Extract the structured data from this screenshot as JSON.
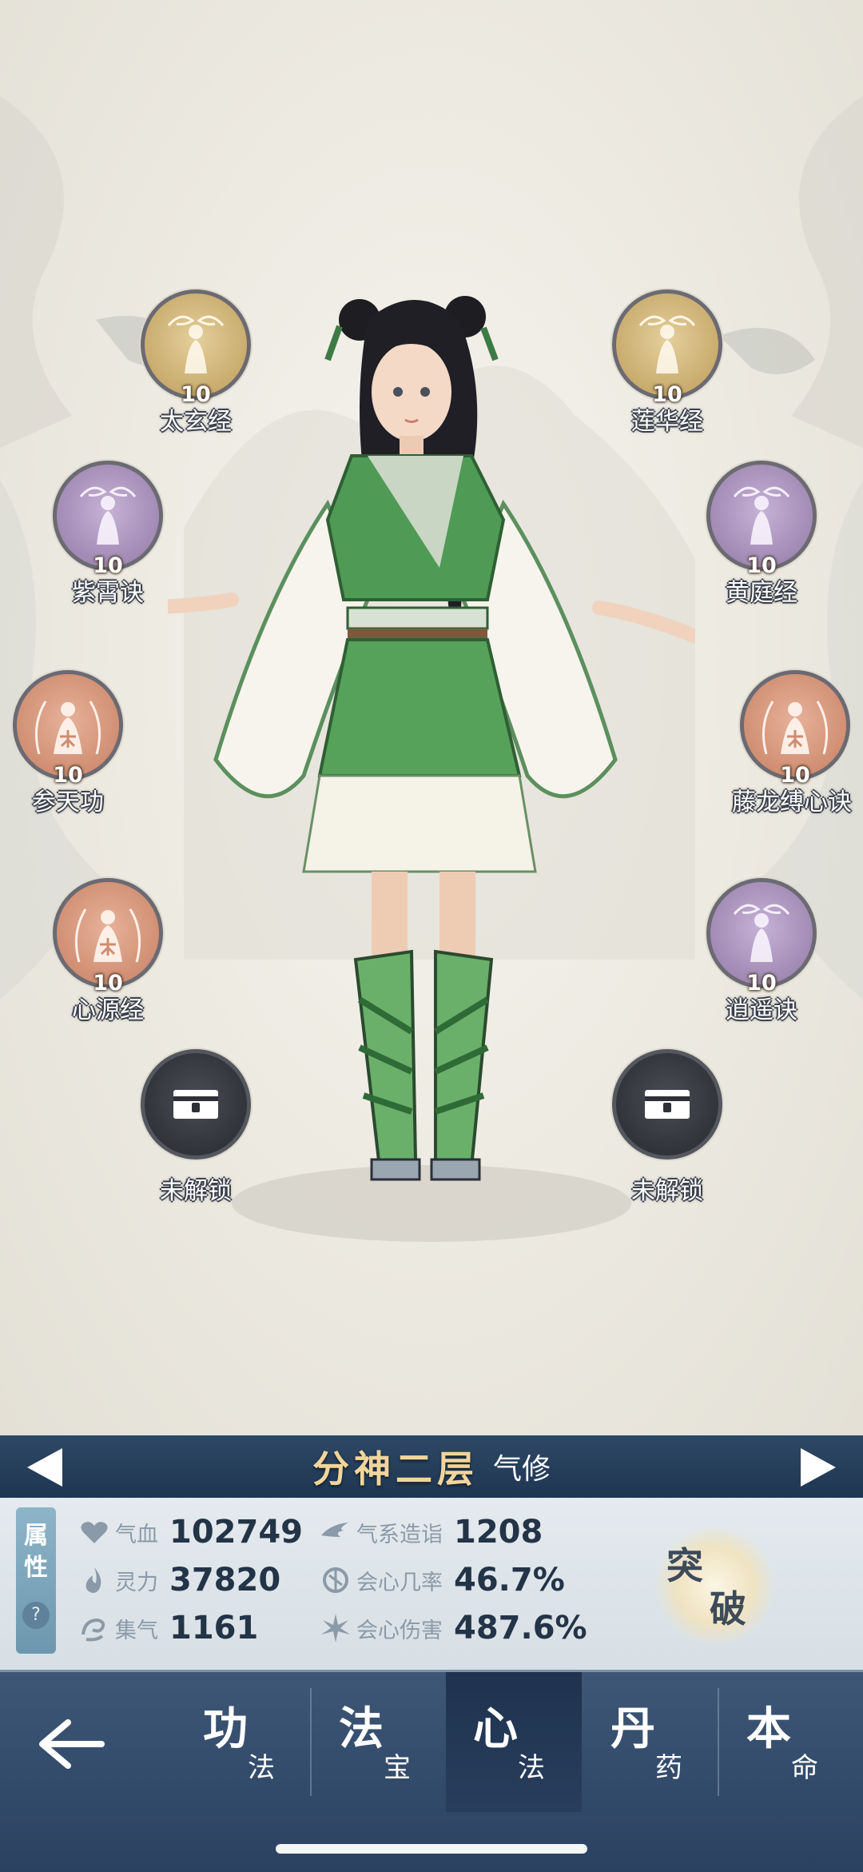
{
  "skills": [
    {
      "name": "太玄经",
      "level": "10",
      "color": "gold",
      "icon": "immortal-figure-icon"
    },
    {
      "name": "莲华经",
      "level": "10",
      "color": "gold",
      "icon": "immortal-figure-icon"
    },
    {
      "name": "紫霄诀",
      "level": "10",
      "color": "purple",
      "icon": "immortal-figure-icon"
    },
    {
      "name": "黄庭经",
      "level": "10",
      "color": "purple",
      "icon": "immortal-figure-icon"
    },
    {
      "name": "参天功",
      "level": "10",
      "color": "orange",
      "icon": "immortal-figure-icon"
    },
    {
      "name": "藤龙缚心诀",
      "level": "10",
      "color": "orange",
      "icon": "immortal-figure-icon"
    },
    {
      "name": "心源经",
      "level": "10",
      "color": "orange",
      "icon": "immortal-figure-icon"
    },
    {
      "name": "逍遥诀",
      "level": "10",
      "color": "purple",
      "icon": "immortal-figure-icon"
    }
  ],
  "locked_slots": [
    {
      "label": "未解锁",
      "icon": "lock-chest-icon"
    },
    {
      "label": "未解锁",
      "icon": "lock-chest-icon"
    }
  ],
  "realm": {
    "name": "分神二层",
    "type": "气修"
  },
  "attributes": {
    "tab_label_1": "属",
    "tab_label_2": "性",
    "help": "?",
    "stats": [
      {
        "label": "气血",
        "value": "102749",
        "icon": "heart-icon"
      },
      {
        "label": "灵力",
        "value": "37820",
        "icon": "flame-icon"
      },
      {
        "label": "集气",
        "value": "1161",
        "icon": "swirl-icon"
      },
      {
        "label": "气系造诣",
        "value": "1208",
        "icon": "wind-icon"
      },
      {
        "label": "会心几率",
        "value": "46.7%",
        "icon": "split-circle-icon"
      },
      {
        "label": "会心伤害",
        "value": "487.6%",
        "icon": "burst-icon"
      }
    ],
    "breakthrough": {
      "char1": "突",
      "char2": "破"
    }
  },
  "nav": {
    "tabs": [
      {
        "big": "功",
        "small": "法",
        "active": false
      },
      {
        "big": "法",
        "small": "宝",
        "active": false
      },
      {
        "big": "心",
        "small": "法",
        "active": true
      },
      {
        "big": "丹",
        "small": "药",
        "active": false
      },
      {
        "big": "本",
        "small": "命",
        "active": false
      }
    ]
  },
  "colors": {
    "gold": "#c7a96a",
    "purple": "#9e87b1",
    "orange": "#cf8c70",
    "realm_text": "#f2d59a",
    "nav_bg": "#324a6a"
  }
}
